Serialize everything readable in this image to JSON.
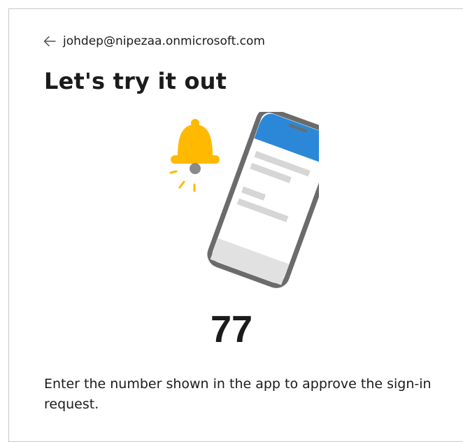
{
  "header": {
    "account": "johdep@nipezaa.onmicrosoft.com",
    "back_icon": "arrow-left-icon"
  },
  "title": "Let's try it out",
  "illustration": {
    "bell_icon": "notification-bell-icon",
    "phone_icon": "phone-icon",
    "colors": {
      "bell": "#FFB900",
      "phone_frame": "#6B6B6B",
      "phone_header": "#2B88D8",
      "phone_footer": "#E1E1E1",
      "placeholder_lines": "#D6D6D6"
    }
  },
  "number_match": "77",
  "instructions": "Enter the number shown in the app to approve the sign-in request."
}
